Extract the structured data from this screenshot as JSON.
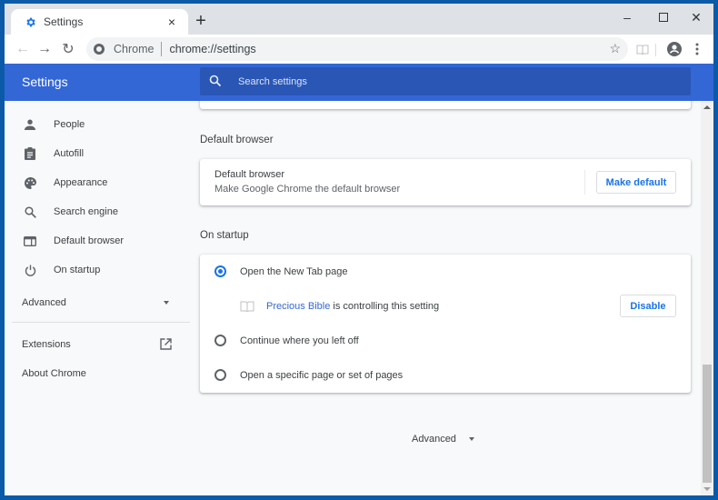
{
  "browser": {
    "tab": {
      "title": "Settings",
      "icon": "gear-icon",
      "close": "×"
    },
    "new_tab": "+",
    "window_controls": {
      "minimize": "–",
      "maximize": "☐",
      "close": "✕"
    },
    "toolbar": {
      "back": "←",
      "forward": "→",
      "reload": "↻",
      "omnibox_chip": "Chrome",
      "url": "chrome://settings",
      "bookmark_star": "☆"
    }
  },
  "header": {
    "title": "Settings",
    "search_placeholder": "Search settings"
  },
  "sidebar": {
    "items": [
      {
        "label": "People",
        "icon": "person-icon"
      },
      {
        "label": "Autofill",
        "icon": "clipboard-icon"
      },
      {
        "label": "Appearance",
        "icon": "palette-icon"
      },
      {
        "label": "Search engine",
        "icon": "search-icon"
      },
      {
        "label": "Default browser",
        "icon": "browser-window-icon"
      },
      {
        "label": "On startup",
        "icon": "power-icon"
      }
    ],
    "advanced": "Advanced",
    "extensions": "Extensions",
    "about": "About Chrome"
  },
  "main": {
    "default_browser": {
      "section_title": "Default browser",
      "row_title": "Default browser",
      "row_subtitle": "Make Google Chrome the default browser",
      "button": "Make default"
    },
    "on_startup": {
      "section_title": "On startup",
      "options": [
        {
          "label": "Open the New Tab page",
          "selected": true
        },
        {
          "label": "Continue where you left off",
          "selected": false
        },
        {
          "label": "Open a specific page or set of pages",
          "selected": false
        }
      ],
      "extension_notice": {
        "extension_name": "Precious Bible",
        "text": " is controlling this setting",
        "button": "Disable"
      }
    },
    "advanced": "Advanced"
  },
  "colors": {
    "header_blue": "#3367d6",
    "search_blue": "#2a56b6",
    "accent": "#1a73e8",
    "frame_blue": "#0b5aa8"
  }
}
